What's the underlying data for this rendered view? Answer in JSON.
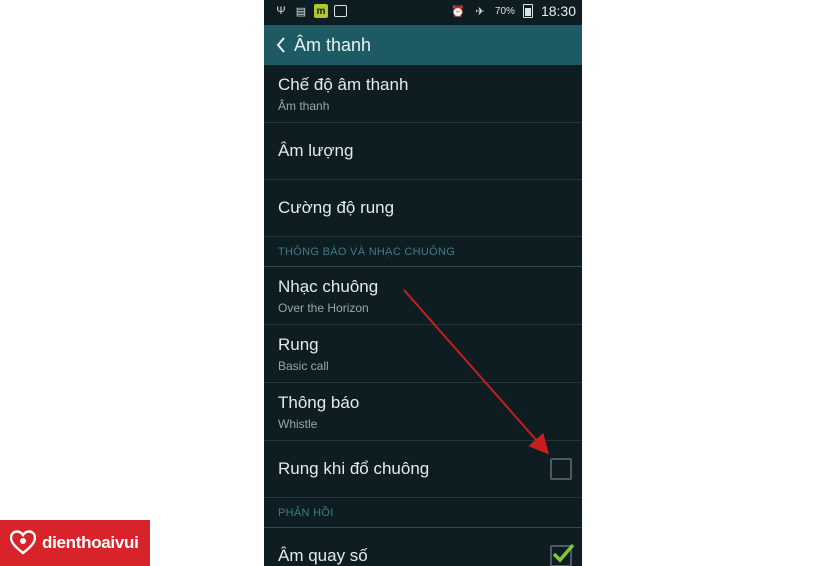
{
  "status_bar": {
    "battery": "70%",
    "time": "18:30",
    "icons": [
      "usb-icon",
      "voicemail-icon",
      "m-app-icon",
      "check-box-icon",
      "alarm-icon",
      "airplane-icon",
      "battery-icon"
    ]
  },
  "action_bar": {
    "title": "Âm thanh"
  },
  "settings": {
    "sound_mode": {
      "label": "Chế độ âm thanh",
      "value": "Âm thanh"
    },
    "volume": {
      "label": "Âm lượng"
    },
    "vibration_intensity": {
      "label": "Cường độ rung"
    },
    "section_notifications": "THÔNG BÁO VÀ NHẠC CHUÔNG",
    "ringtone": {
      "label": "Nhạc chuông",
      "value": "Over the Horizon"
    },
    "vibration": {
      "label": "Rung",
      "value": "Basic call"
    },
    "notification": {
      "label": "Thông báo",
      "value": "Whistle"
    },
    "vibrate_when_ringing": {
      "label": "Rung khi đổ chuông",
      "checked": false
    },
    "section_feedback": "PHẢN HỒI",
    "dialing_keypad_tone": {
      "label": "Âm quay số",
      "checked": true
    }
  },
  "annotation": {
    "arrow_color": "#c81e1e"
  },
  "brand": {
    "name": "dienthoaivui",
    "color": "#d8232a"
  },
  "colors": {
    "background": "#0d1d22",
    "action_bar": "#1e5a63",
    "section_header": "#3f7c86",
    "check_green": "#7cc63f"
  }
}
